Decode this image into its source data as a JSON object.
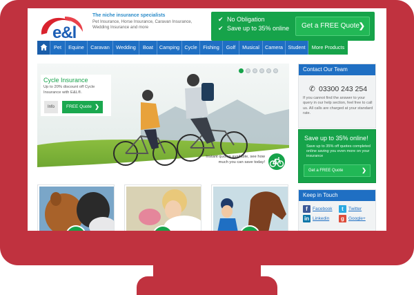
{
  "brand": {
    "logo_text": "e&l"
  },
  "header": {
    "tagline_title": "The niche insurance specialists",
    "tagline_desc": "Pet Insurance, Horse Insurance, Caravan Insurance, Wedding Insurance and more"
  },
  "promo": {
    "features": [
      "No Obligation",
      "Save up to 35% online"
    ],
    "button_label": "Get a FREE Quote"
  },
  "nav": {
    "items": [
      "Pet",
      "Equine",
      "Caravan",
      "Wedding",
      "Boat",
      "Camping",
      "Cycle",
      "Fishing",
      "Golf",
      "Musical",
      "Camera",
      "Student"
    ],
    "more_label": "More Products"
  },
  "hero": {
    "title": "Cycle Insurance",
    "desc": "Up to 20% discount off Cycle Insurance with E&L®.",
    "info_label": "Info",
    "quote_label": "FREE Quote",
    "instant_text": "Instant quotes available, see how much you can save today!",
    "slides": 6,
    "active_slide": 1
  },
  "contact": {
    "title": "Contact Our Team",
    "phone": "03300 243 254",
    "text": "If you cannot find the answer to your query in our help section, feel free to call us. All calls are charged at your standard rate."
  },
  "save": {
    "title": "Save up to 35% online!",
    "desc": "Save up to 35% off quotes completed online saving you even more on your insurance",
    "button_label": "Get a FREE Quote"
  },
  "social": {
    "title": "Keep in Touch",
    "links": [
      "Facebook",
      "Twitter",
      "Linkedin",
      "Google+"
    ]
  },
  "colors": {
    "primary_blue": "#1f6fc3",
    "green": "#16a34a",
    "frame_red": "#c0323f"
  }
}
